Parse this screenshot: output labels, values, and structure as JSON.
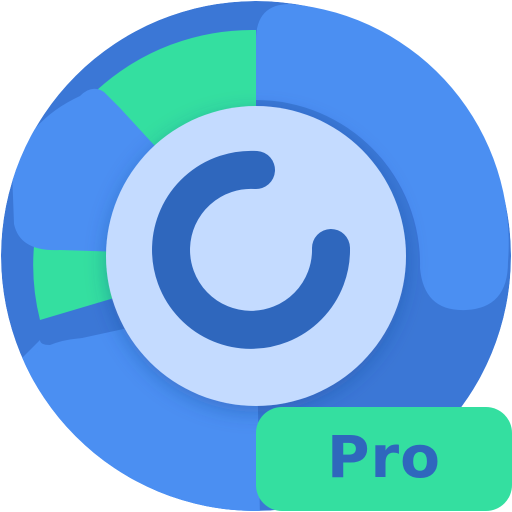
{
  "app_icon": {
    "icon_name": "circular-refresh-progress-icon",
    "badge_label": "Pro",
    "colors": {
      "primary_blue": "#4b8ff2",
      "dark_blue": "#3b77d6",
      "green": "#34dfa0",
      "inner_circle": "#c4dbff",
      "ring_glyph": "#2f67bd",
      "badge_background": "#34dfa0",
      "badge_text": "#2f67bd"
    }
  }
}
